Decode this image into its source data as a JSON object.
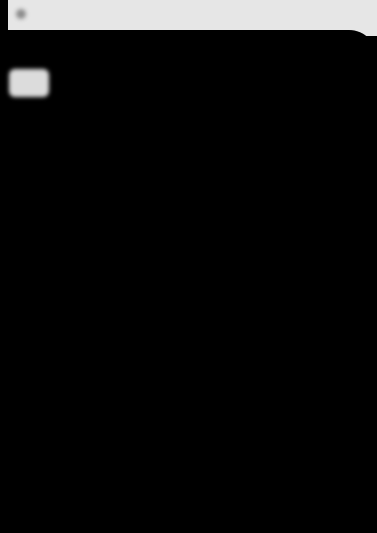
{
  "header": {
    "title": "",
    "icon": "app-icon"
  },
  "colors": {
    "background": "#000000",
    "top_strip": "#e6e6e6",
    "highlight": "#dcdcdc",
    "muted_text": "#7a7a7a"
  },
  "menu": {
    "items": [
      {
        "label": ""
      },
      {
        "label": ""
      }
    ]
  }
}
